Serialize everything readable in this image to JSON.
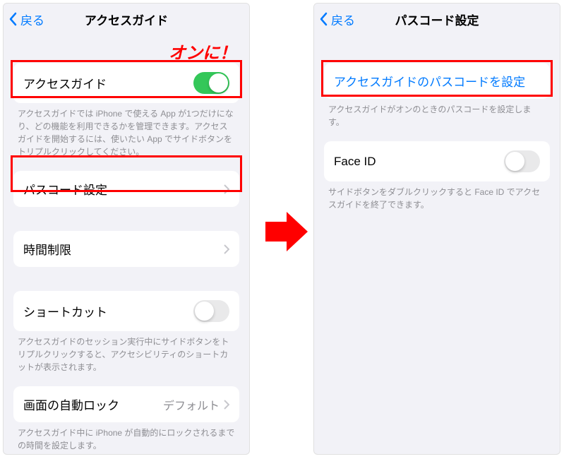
{
  "annotation": "オンに！",
  "left": {
    "nav": {
      "back": "戻る",
      "title": "アクセスガイド"
    },
    "accessGuide": {
      "label": "アクセスガイド"
    },
    "accessGuideFooter": "アクセスガイドでは iPhone で使える App が1つだけになり、どの機能を利用できるかを管理できます。アクセスガイドを開始するには、使いたい App でサイドボタンをトリプルクリックしてください。",
    "passcode": {
      "label": "パスコード設定"
    },
    "timeLimit": {
      "label": "時間制限"
    },
    "shortcut": {
      "label": "ショートカット"
    },
    "shortcutFooter": "アクセスガイドのセッション実行中にサイドボタンをトリプルクリックすると、アクセシビリティのショートカットが表示されます。",
    "autoLock": {
      "label": "画面の自動ロック",
      "value": "デフォルト"
    },
    "autoLockFooter": "アクセスガイド中に iPhone が自動的にロックされるまでの時間を設定します。"
  },
  "right": {
    "nav": {
      "back": "戻る",
      "title": "パスコード設定"
    },
    "setPasscode": {
      "label": "アクセスガイドのパスコードを設定"
    },
    "setPasscodeFooter": "アクセスガイドがオンのときのパスコードを設定します。",
    "faceId": {
      "label": "Face ID"
    },
    "faceIdFooter": "サイドボタンをダブルクリックすると Face ID でアクセスガイドを終了できます。"
  }
}
